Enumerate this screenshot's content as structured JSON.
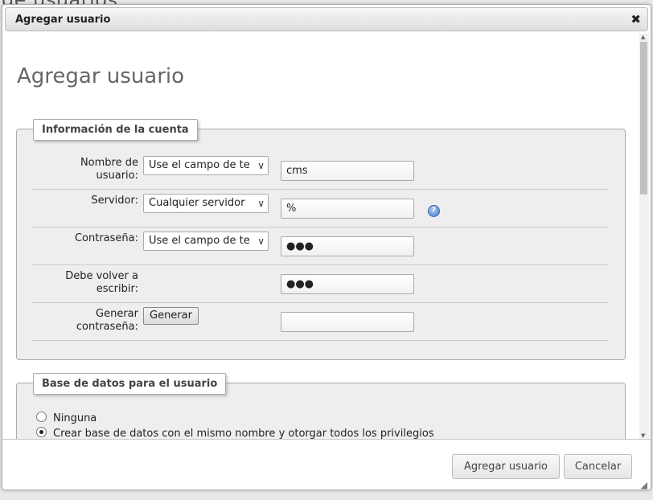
{
  "background": {
    "title": "de usuarios"
  },
  "dialog": {
    "title": "Agregar usuario",
    "close_icon": "close-icon",
    "heading": "Agregar usuario"
  },
  "account": {
    "legend": "Información de la cuenta",
    "username": {
      "label": "Nombre de usuario:",
      "select": "Use el campo de te",
      "value": "cms"
    },
    "server": {
      "label": "Servidor:",
      "select": "Cualquier servidor",
      "value": "%",
      "help_icon": "help-icon"
    },
    "password": {
      "label": "Contraseña:",
      "select": "Use el campo de te",
      "value": "●●●"
    },
    "retype": {
      "label": "Debe volver a escribir:",
      "value": "●●●"
    },
    "generate": {
      "label": "Generar contraseña:",
      "button": "Generar",
      "value": ""
    }
  },
  "database": {
    "legend": "Base de datos para el usuario",
    "options": [
      {
        "label": "Ninguna",
        "checked": false
      },
      {
        "label": "Crear base de datos con el mismo nombre y otorgar todos los privilegios",
        "checked": true
      }
    ]
  },
  "footer": {
    "submit": "Agregar usuario",
    "cancel": "Cancelar"
  }
}
